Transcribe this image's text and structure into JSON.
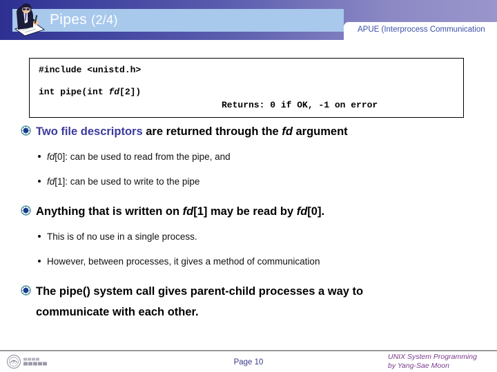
{
  "header": {
    "title_main": "Pipes",
    "title_num": "(2/4)",
    "writer_icon": "writing-person-icon",
    "apue_label": "APUE (Interprocess Communication"
  },
  "code_box": {
    "include_line": "#include <unistd.h>",
    "prototype_prefix": "int pipe(int ",
    "prototype_param": "fd",
    "prototype_suffix": "[2])",
    "returns_line": "Returns: 0 if OK, -1 on error"
  },
  "content": {
    "blocks": [
      {
        "marker": "ornament-bullet-icon",
        "lead_text": "Two file descriptors",
        "rest_prefix": " are returned through the ",
        "rest_italic": "fd",
        "rest_suffix": " argument",
        "subs": [
          {
            "italic": "fd",
            "text": "[0]: can be used to read from the pipe, and"
          },
          {
            "italic": "fd",
            "text": "[1]: can be used to write to the pipe"
          }
        ]
      },
      {
        "marker": "ornament-bullet-icon",
        "p1": "Anything that is written on ",
        "i1": "fd",
        "p2": "[1] may be read by ",
        "i2": "fd",
        "p3": "[0].",
        "subs": [
          {
            "text": "This is of no use in a single process."
          },
          {
            "text": "However, between processes, it gives a method of communication"
          }
        ]
      },
      {
        "marker": "ornament-bullet-icon",
        "text": "The pipe() system call gives parent-child processes a way to communicate with each other."
      }
    ]
  },
  "footer": {
    "logo": "university-seal-logo",
    "page_label": "Page 10",
    "credit_line1": "UNIX System Programming",
    "credit_line2": "by Yang-Sae Moon"
  },
  "colors": {
    "header_gradient_start": "#2d2f91",
    "header_gradient_end": "#9a96cc",
    "title_band": "#a8c8ec",
    "accent_blue": "#3b3a9e",
    "apue_text": "#3b4fa8",
    "page_num": "#3b3a8e",
    "credit_purple": "#7a3a8a"
  }
}
